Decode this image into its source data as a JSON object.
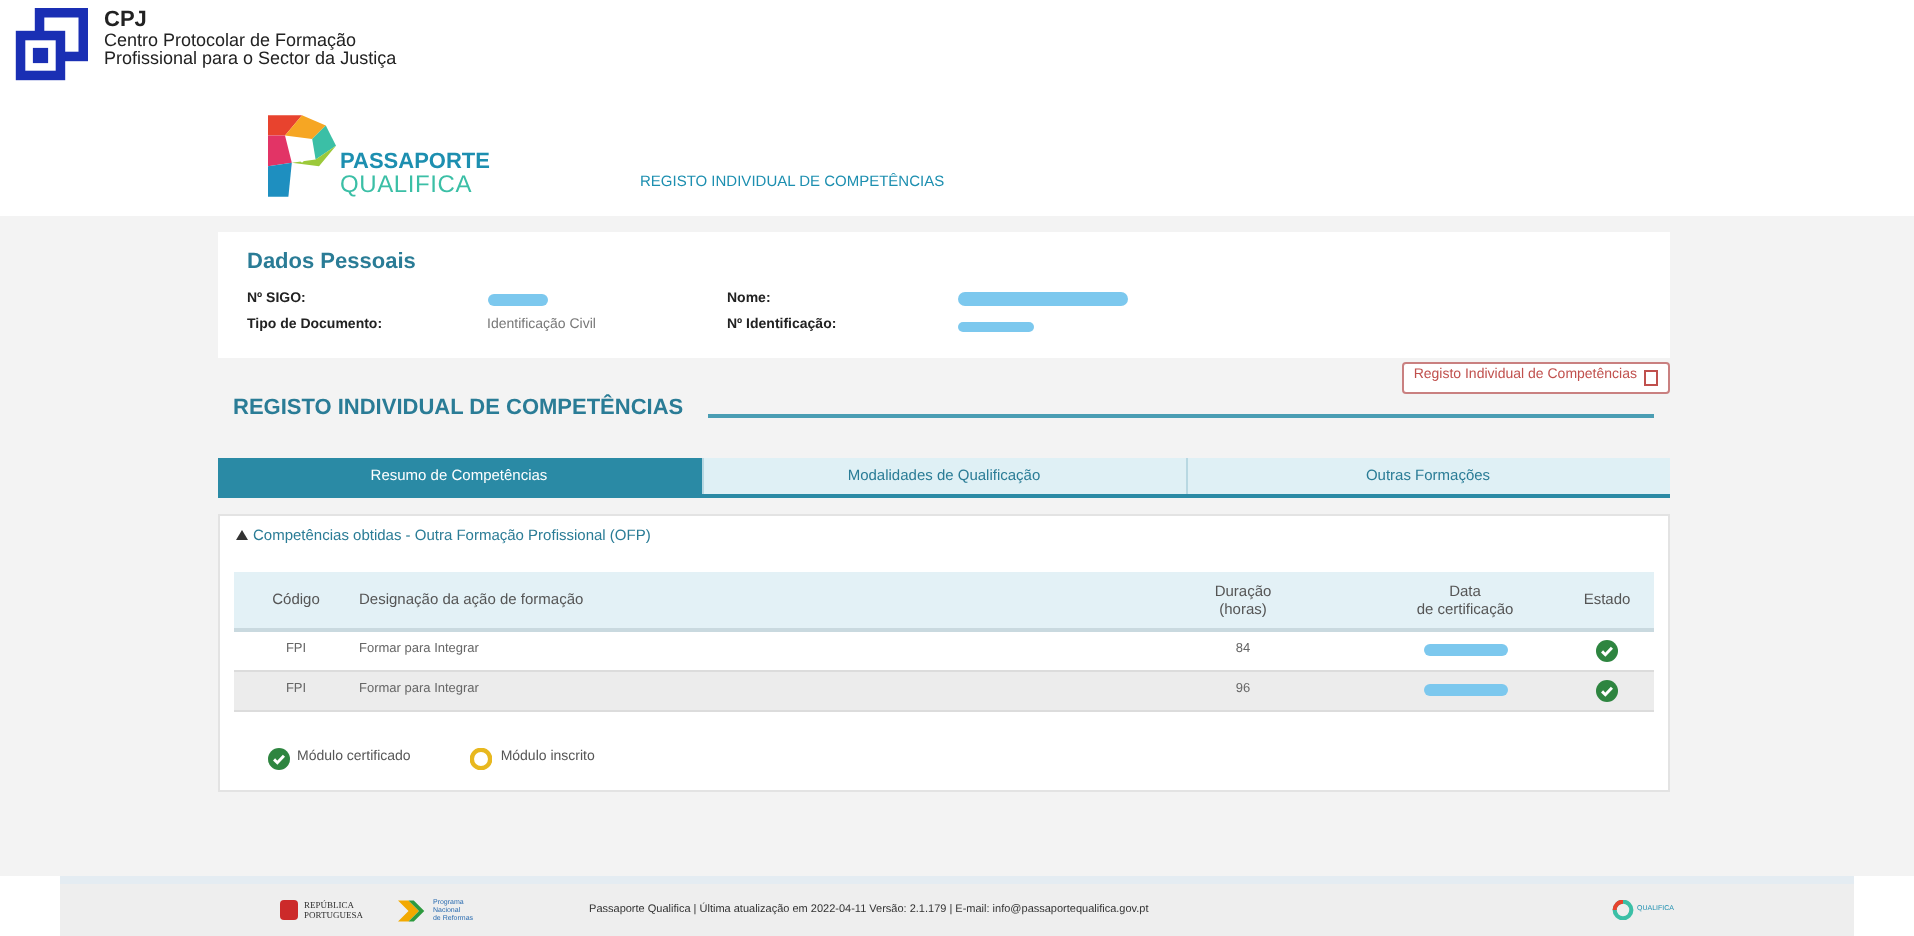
{
  "org": {
    "acronym": "CPJ",
    "line_1": "Centro Protocolar de Formação",
    "line_2": "Profissional para o Sector da Justiça"
  },
  "brand": {
    "line_1": "PASSAPORTE",
    "line_2": "QUALIFICA",
    "page_title": "REGISTO INDIVIDUAL DE COMPETÊNCIAS"
  },
  "personal": {
    "title": "Dados Pessoais",
    "fields": [
      {
        "label": "Nº SIGO:",
        "redacted": true
      },
      {
        "label": "Nome:",
        "redacted": true
      },
      {
        "label": "Tipo de Documento:",
        "value": "Identificação Civil"
      },
      {
        "label": "Nº Identificação:",
        "redacted": true
      }
    ]
  },
  "section_title": "REGISTO INDIVIDUAL DE COMPETÊNCIAS",
  "pdf_button": "Registo Individual de Competências",
  "tabs": [
    {
      "label": "Resumo de Competências",
      "selected": true
    },
    {
      "label": "Modalidades de Qualificação",
      "selected": false
    },
    {
      "label": "Outras Formações",
      "selected": false
    }
  ],
  "panel": {
    "title": "Competências obtidas - Outra Formação Profissional (OFP)",
    "expanded": true,
    "columns": [
      "Código",
      "Designação da ação de formação",
      "Duração\n(horas)",
      "Data\nde certificação",
      "Estado"
    ],
    "rows": [
      {
        "code": "FPI",
        "name": "Formar para Integrar",
        "hours": "84",
        "kind": "certified"
      },
      {
        "code": "FPI",
        "name": "Formar para Integrar",
        "hours": "96",
        "kind": "certified"
      }
    ],
    "legend": [
      {
        "kind": "certified",
        "label": "Módulo certificado"
      },
      {
        "kind": "enrolled",
        "label": "Módulo inscrito"
      }
    ]
  },
  "footer": {
    "republic": "REPÚBLICA\nPORTUGUESA",
    "program": "Programa\nNacional\nde Reformas",
    "text": "Passaporte Qualifica | Última atualização em 2022-04-11 Versão: 2.1.179 | E-mail: info@passaportequalifica.gov.pt",
    "logo": "QUALIFICA"
  }
}
